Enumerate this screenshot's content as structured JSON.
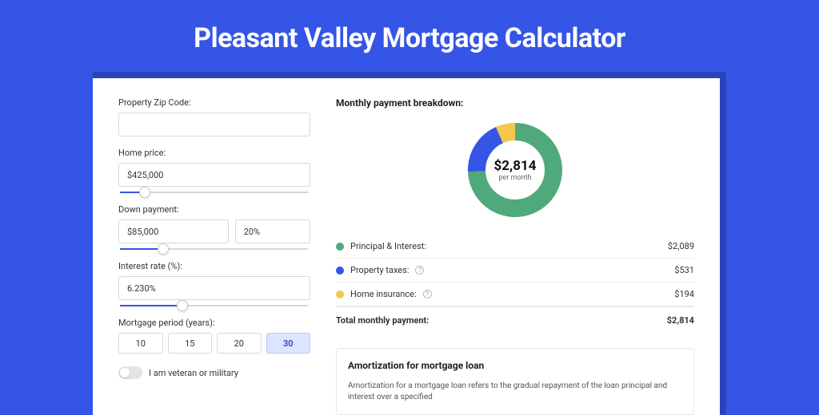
{
  "hero_title": "Pleasant Valley Mortgage Calculator",
  "form": {
    "zip_label": "Property Zip Code:",
    "zip_value": "",
    "home_price_label": "Home price:",
    "home_price_value": "$425,000",
    "home_price_slider_pct": 10,
    "down_payment_label": "Down payment:",
    "down_payment_value": "$85,000",
    "down_payment_pct_value": "20%",
    "down_payment_slider_pct": 20,
    "interest_label": "Interest rate (%):",
    "interest_value": "6.230%",
    "interest_slider_pct": 30,
    "period_label": "Mortgage period (years):",
    "periods": [
      "10",
      "15",
      "20",
      "30"
    ],
    "period_selected": "30",
    "veteran_label": "I am veteran or military"
  },
  "breakdown": {
    "title": "Monthly payment breakdown:",
    "center_amount": "$2,814",
    "center_sub": "per month",
    "items": [
      {
        "label": "Principal & Interest:",
        "value": "$2,089",
        "color": "green",
        "info": false
      },
      {
        "label": "Property taxes:",
        "value": "$531",
        "color": "blue",
        "info": true
      },
      {
        "label": "Home insurance:",
        "value": "$194",
        "color": "yellow",
        "info": true
      }
    ],
    "total_label": "Total monthly payment:",
    "total_value": "$2,814"
  },
  "amortization": {
    "title": "Amortization for mortgage loan",
    "text": "Amortization for a mortgage loan refers to the gradual repayment of the loan principal and interest over a specified"
  },
  "chart_data": {
    "type": "pie",
    "title": "Monthly payment breakdown",
    "series": [
      {
        "name": "Principal & Interest",
        "value": 2089,
        "color": "#4fa97b"
      },
      {
        "name": "Property taxes",
        "value": 531,
        "color": "#3555e6"
      },
      {
        "name": "Home insurance",
        "value": 194,
        "color": "#f2c94c"
      }
    ],
    "total": 2814,
    "unit": "USD per month"
  }
}
